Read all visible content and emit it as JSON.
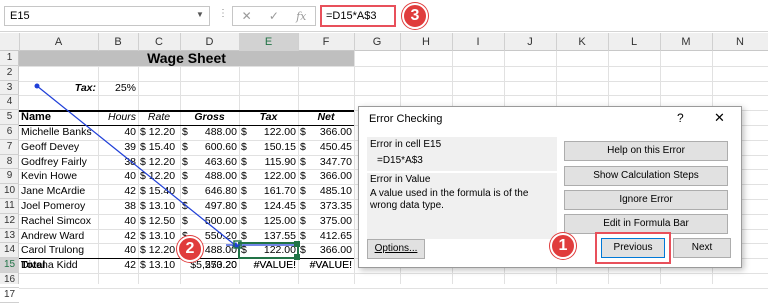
{
  "formula_bar": {
    "name_box": "E15",
    "formula": "=D15*A$3",
    "icons": [
      "cancel-icon",
      "enter-icon",
      "fx-icon"
    ],
    "icon_glyphs": [
      "✕",
      "✓",
      "fx"
    ]
  },
  "columns": [
    "A",
    "B",
    "C",
    "D",
    "E",
    "F",
    "G",
    "H",
    "I",
    "J",
    "K",
    "L",
    "M",
    "N"
  ],
  "rows": [
    "1",
    "2",
    "3",
    "4",
    "5",
    "6",
    "7",
    "8",
    "9",
    "10",
    "11",
    "12",
    "13",
    "14",
    "15",
    "16",
    "17"
  ],
  "sheet": {
    "title": "Wage Sheet",
    "tax_label": "Tax:",
    "tax_value": "25%",
    "headers": [
      "Name",
      "Hours",
      "Rate",
      "Gross",
      "Tax",
      "Net"
    ],
    "data_rows": [
      {
        "name": "Michelle Banks",
        "hours": "40",
        "rate": "$ 12.20",
        "gross_s": "$",
        "gross": "488.00",
        "tax_s": "$",
        "tax": "122.00",
        "net_s": "$",
        "net": "366.00"
      },
      {
        "name": "Geoff Devey",
        "hours": "39",
        "rate": "$ 15.40",
        "gross_s": "$",
        "gross": "600.60",
        "tax_s": "$",
        "tax": "150.15",
        "net_s": "$",
        "net": "450.45"
      },
      {
        "name": "Godfrey Fairly",
        "hours": "38",
        "rate": "$ 12.20",
        "gross_s": "$",
        "gross": "463.60",
        "tax_s": "$",
        "tax": "115.90",
        "net_s": "$",
        "net": "347.70"
      },
      {
        "name": "Kevin Howe",
        "hours": "40",
        "rate": "$ 12.20",
        "gross_s": "$",
        "gross": "488.00",
        "tax_s": "$",
        "tax": "122.00",
        "net_s": "$",
        "net": "366.00"
      },
      {
        "name": "Jane McArdie",
        "hours": "42",
        "rate": "$ 15.40",
        "gross_s": "$",
        "gross": "646.80",
        "tax_s": "$",
        "tax": "161.70",
        "net_s": "$",
        "net": "485.10"
      },
      {
        "name": "Joel Pomeroy",
        "hours": "38",
        "rate": "$ 13.10",
        "gross_s": "$",
        "gross": "497.80",
        "tax_s": "$",
        "tax": "124.45",
        "net_s": "$",
        "net": "373.35"
      },
      {
        "name": "Rachel Simcox",
        "hours": "40",
        "rate": "$ 12.50",
        "gross_s": "$",
        "gross": "500.00",
        "tax_s": "$",
        "tax": "125.00",
        "net_s": "$",
        "net": "375.00"
      },
      {
        "name": "Andrew Ward",
        "hours": "42",
        "rate": "$ 13.10",
        "gross_s": "$",
        "gross": "550.20",
        "tax_s": "$",
        "tax": "137.55",
        "net_s": "$",
        "net": "412.65"
      },
      {
        "name": "Carol Trulong",
        "hours": "40",
        "rate": "$ 12.20",
        "gross_s": "$",
        "gross": "488.00",
        "tax_s": "$",
        "tax": "122.00",
        "net_s": "$",
        "net": "366.00"
      },
      {
        "name": "Divena Kidd",
        "hours": "42",
        "rate": "$ 13.10",
        "gross_s": "",
        "gross": "550.20",
        "tax_s": "",
        "tax": "#VALUE!",
        "net_s": "",
        "net": "#VALUE!"
      }
    ],
    "total_label": "Total",
    "total_gross": "$5,273.20",
    "total_tax": "#VALUE!",
    "total_net": "#VALUE!"
  },
  "dialog": {
    "title": "Error Checking",
    "help_glyph": "?",
    "close_glyph": "✕",
    "error_in_cell": "Error in cell E15",
    "cell_formula": "=D15*A$3",
    "error_in_value": "Error in Value",
    "description": "A value used in the formula is of the wrong data type.",
    "buttons": {
      "help": "Help on this Error",
      "steps": "Show Calculation Steps",
      "ignore": "Ignore Error",
      "edit": "Edit in Formula Bar",
      "options": "Options...",
      "previous": "Previous",
      "next": "Next"
    }
  },
  "badges": [
    "1",
    "2",
    "3"
  ],
  "colors": {
    "badge_red": "#e03c3c",
    "excel_green": "#217346",
    "trace_blue": "#1f3fd8"
  }
}
